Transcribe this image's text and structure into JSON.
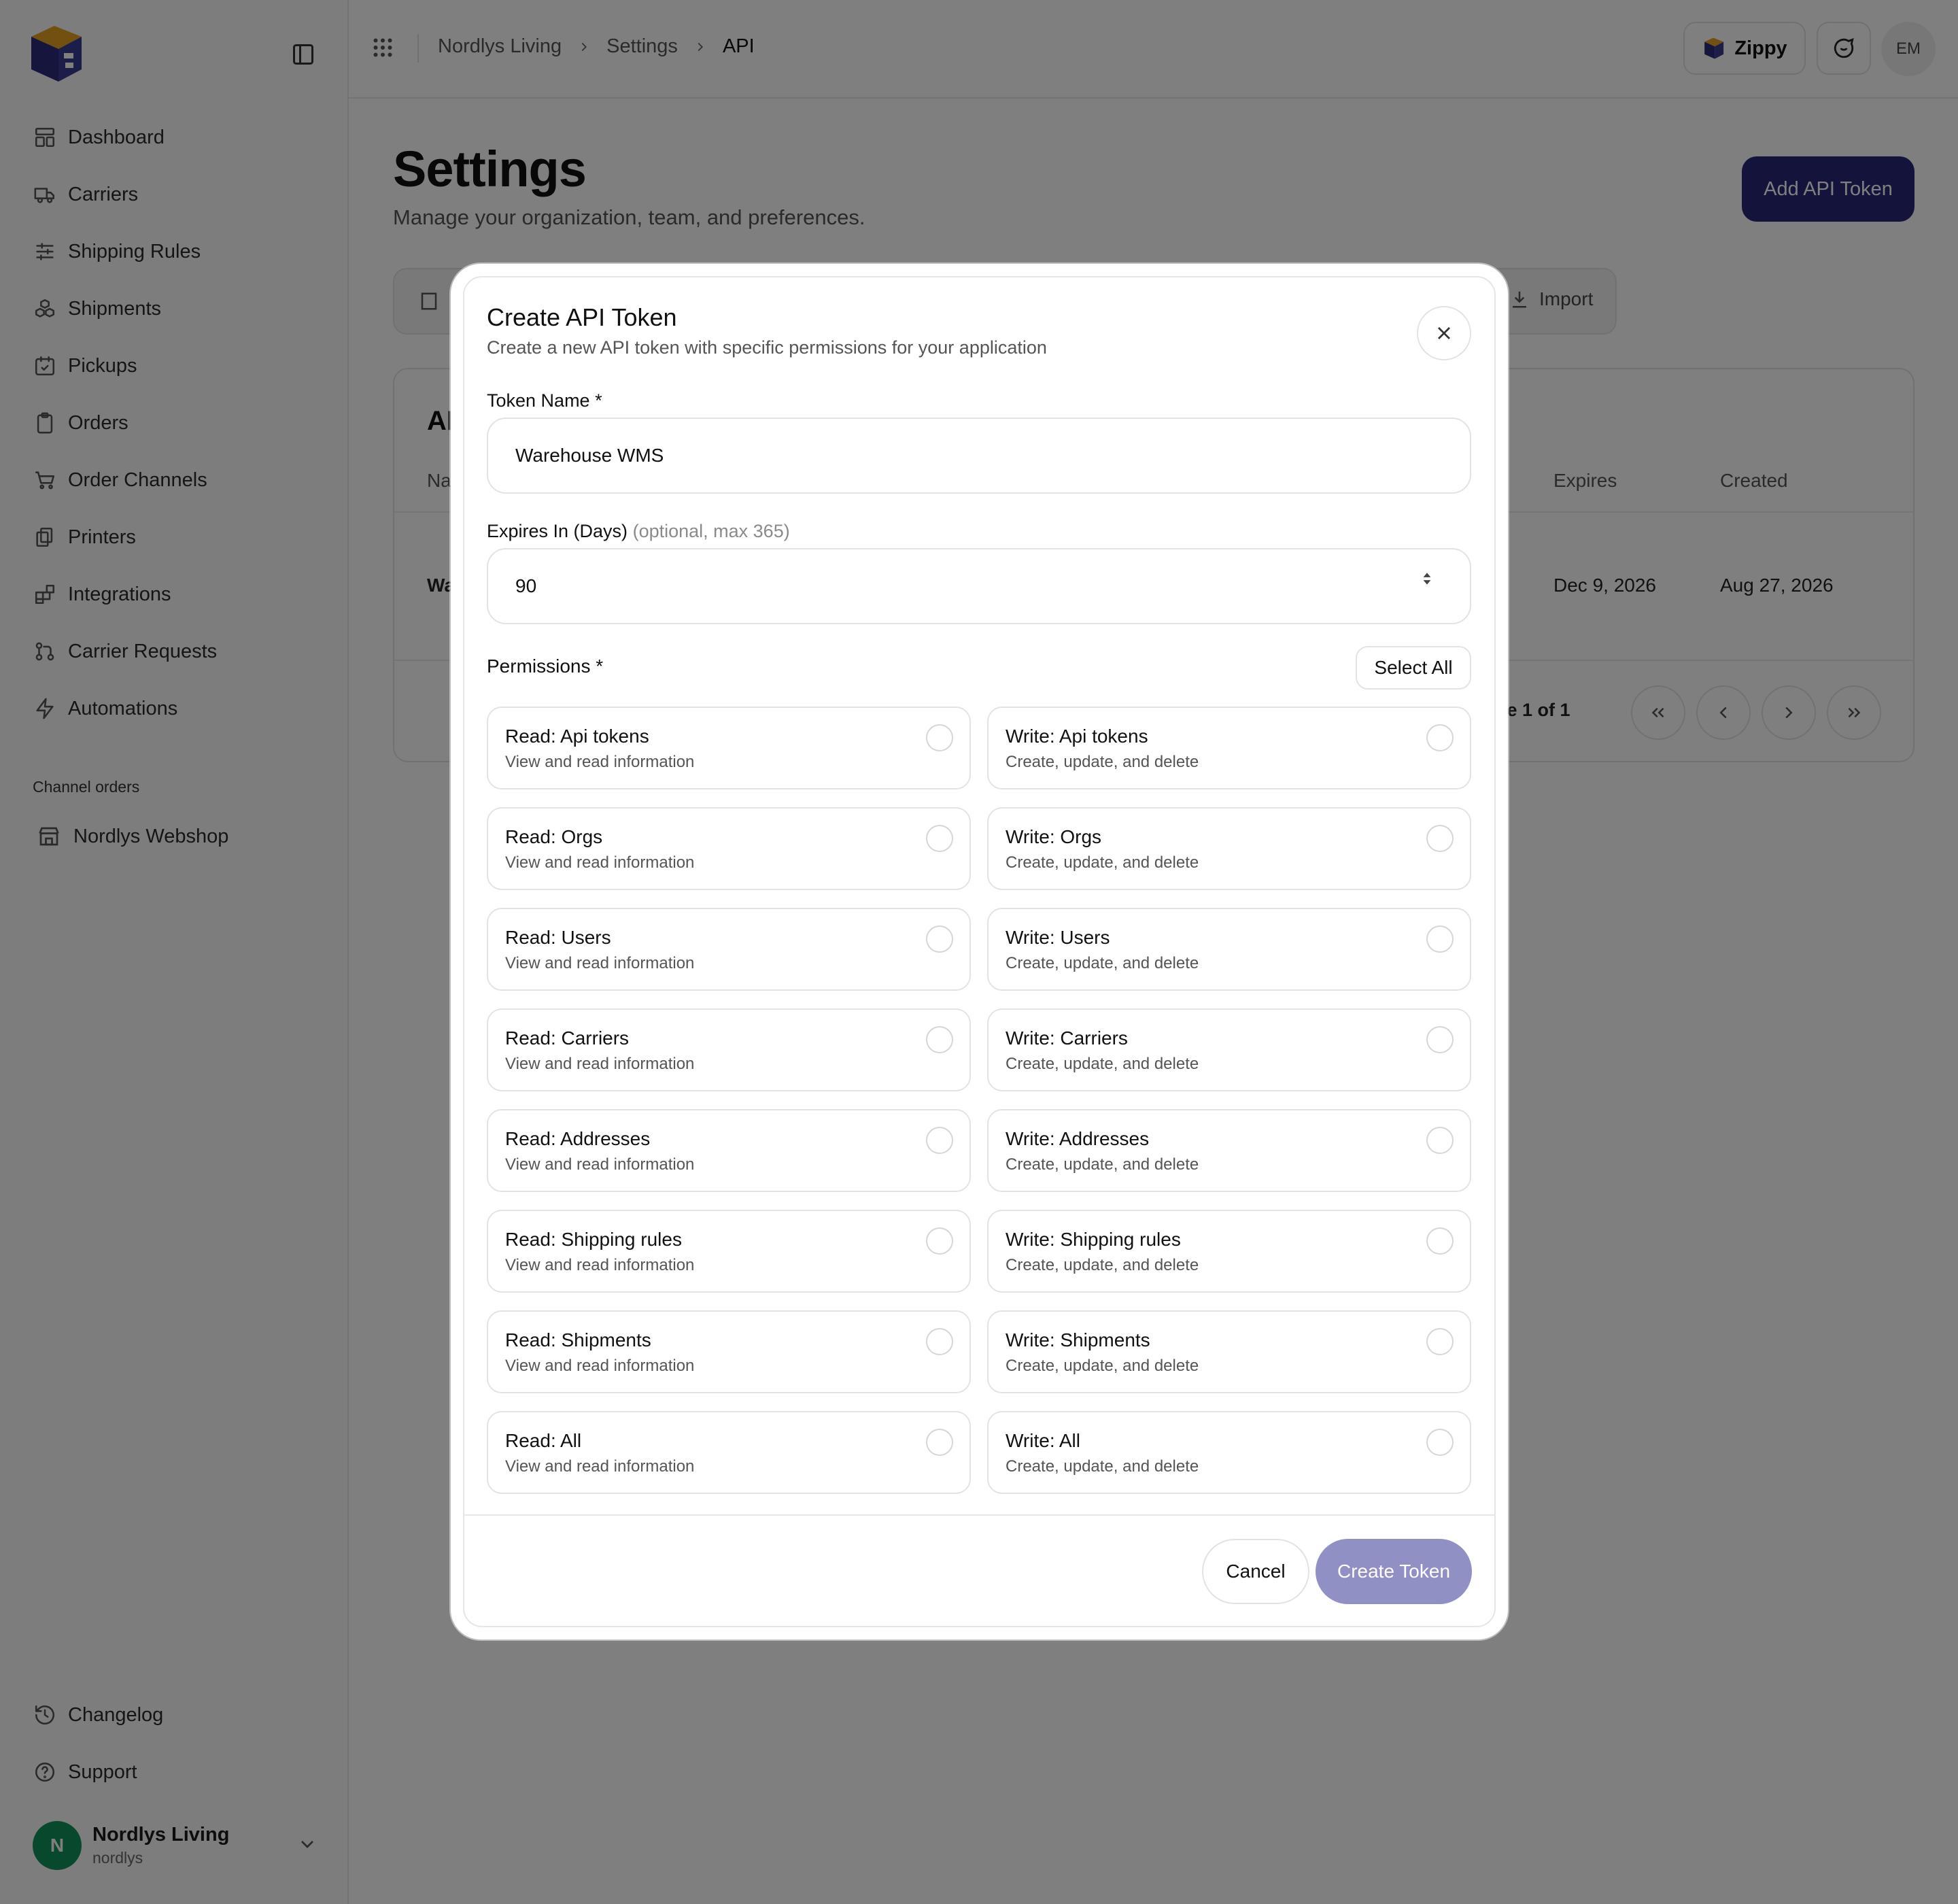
{
  "breadcrumb": [
    "Nordlys Living",
    "Settings",
    "API"
  ],
  "topbar": {
    "assistant_label": "Zippy",
    "user_initials": "EM"
  },
  "sidebar": {
    "items": [
      {
        "label": "Dashboard",
        "icon": "dashboard-icon"
      },
      {
        "label": "Carriers",
        "icon": "truck-icon"
      },
      {
        "label": "Shipping Rules",
        "icon": "sliders-icon"
      },
      {
        "label": "Shipments",
        "icon": "boxes-icon"
      },
      {
        "label": "Pickups",
        "icon": "calendar-check-icon"
      },
      {
        "label": "Orders",
        "icon": "clipboard-icon"
      },
      {
        "label": "Order Channels",
        "icon": "cart-icon"
      },
      {
        "label": "Printers",
        "icon": "printer-icon"
      },
      {
        "label": "Integrations",
        "icon": "blocks-icon"
      },
      {
        "label": "Carrier Requests",
        "icon": "git-pull-icon"
      },
      {
        "label": "Automations",
        "icon": "zap-icon"
      }
    ],
    "section_label": "Channel orders",
    "channel": "Nordlys Webshop",
    "bottom_items": [
      {
        "label": "Changelog",
        "icon": "history-icon"
      },
      {
        "label": "Support",
        "icon": "help-circle-icon"
      }
    ],
    "org": {
      "initial": "N",
      "name": "Nordlys Living",
      "slug": "nordlys",
      "color": "#11935a"
    }
  },
  "page": {
    "title": "Settings",
    "subtitle": "Manage your organization, team, and preferences.",
    "add_button": "Add API Token",
    "tab_import": "Import",
    "tab_partial": "C",
    "card_title_partial": "AP",
    "columns_partial": "Nar",
    "columns": [
      "Expires",
      "Created"
    ],
    "row": {
      "name_partial": "Wa",
      "expires": "Dec 9, 2026",
      "created": "Aug 27, 2026"
    },
    "pager_partial": "ge 1 of 1"
  },
  "modal": {
    "title": "Create API Token",
    "description": "Create a new API token with specific permissions for your application",
    "token_name_label": "Token Name *",
    "token_name_value": "Warehouse WMS",
    "expires_label": "Expires In (Days)",
    "expires_hint": "(optional, max 365)",
    "expires_value": "90",
    "permissions_label": "Permissions *",
    "select_all": "Select All",
    "permissions": [
      {
        "title": "Read: Api tokens",
        "desc": "View and read information"
      },
      {
        "title": "Write: Api tokens",
        "desc": "Create, update, and delete"
      },
      {
        "title": "Read: Orgs",
        "desc": "View and read information"
      },
      {
        "title": "Write: Orgs",
        "desc": "Create, update, and delete"
      },
      {
        "title": "Read: Users",
        "desc": "View and read information"
      },
      {
        "title": "Write: Users",
        "desc": "Create, update, and delete"
      },
      {
        "title": "Read: Carriers",
        "desc": "View and read information"
      },
      {
        "title": "Write: Carriers",
        "desc": "Create, update, and delete"
      },
      {
        "title": "Read: Addresses",
        "desc": "View and read information"
      },
      {
        "title": "Write: Addresses",
        "desc": "Create, update, and delete"
      },
      {
        "title": "Read: Shipping rules",
        "desc": "View and read information"
      },
      {
        "title": "Write: Shipping rules",
        "desc": "Create, update, and delete"
      },
      {
        "title": "Read: Shipments",
        "desc": "View and read information"
      },
      {
        "title": "Write: Shipments",
        "desc": "Create, update, and delete"
      },
      {
        "title": "Read: All",
        "desc": "View and read information"
      },
      {
        "title": "Write: All",
        "desc": "Create, update, and delete"
      }
    ],
    "cancel": "Cancel",
    "create": "Create Token"
  },
  "colors": {
    "primary": "#262677",
    "primary_disabled": "#9090c4",
    "overlay": "rgba(0,0,0,0.5)"
  }
}
